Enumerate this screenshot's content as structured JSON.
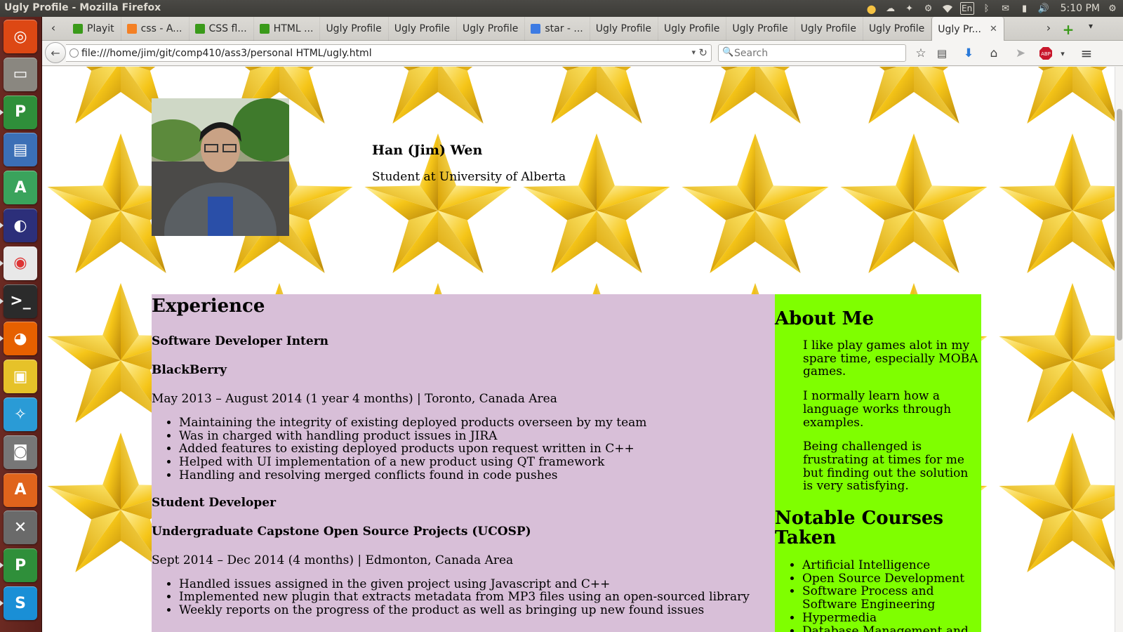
{
  "window": {
    "title": "Ugly Profile - Mozilla Firefox"
  },
  "panel": {
    "keyboard_layout": "En",
    "clock": "5:10 PM"
  },
  "launcher": {
    "items": [
      "Dash Home",
      "Files",
      "PyCharm",
      "LibreOffice Writer",
      "Android Studio",
      "Eclipse",
      "Google Chrome",
      "Terminal",
      "Firefox",
      "Impress",
      "Cursor Tool",
      "Camera",
      "Software Center",
      "System Settings",
      "PyCharm",
      "Skype"
    ]
  },
  "tabs": [
    {
      "label": "Playit",
      "favicon": "green"
    },
    {
      "label": "css - A...",
      "favicon": "stack"
    },
    {
      "label": "CSS fl...",
      "favicon": "green"
    },
    {
      "label": "HTML ...",
      "favicon": "green"
    },
    {
      "label": "Ugly Profile",
      "favicon": "none"
    },
    {
      "label": "Ugly Profile",
      "favicon": "none"
    },
    {
      "label": "Ugly Profile",
      "favicon": "none"
    },
    {
      "label": "star - ...",
      "favicon": "google"
    },
    {
      "label": "Ugly Profile",
      "favicon": "none"
    },
    {
      "label": "Ugly Profile",
      "favicon": "none"
    },
    {
      "label": "Ugly Profile",
      "favicon": "none"
    },
    {
      "label": "Ugly Profile",
      "favicon": "none"
    },
    {
      "label": "Ugly Profile",
      "favicon": "none"
    },
    {
      "label": "Ugly Pr...",
      "favicon": "none",
      "active": true
    }
  ],
  "navbar": {
    "url": "file:///home/jim/git/comp410/ass3/personal HTML/ugly.html",
    "search_placeholder": "Search"
  },
  "profile": {
    "name": "Han (Jim) Wen",
    "tagline": "Student at University of Alberta"
  },
  "experience": {
    "heading": "Experience",
    "jobs": [
      {
        "title": "Software Developer Intern",
        "company": "BlackBerry",
        "period": "May 2013 – August 2014 (1 year 4 months) | Toronto, Canada Area",
        "duties": [
          "Maintaining the integrity of existing deployed products overseen by my team",
          "Was in charged with handling product issues in JIRA",
          "Added features to existing deployed products upon request written in C++",
          "Helped with UI implementation of a new product using QT framework",
          "Handling and resolving merged conflicts found in code pushes"
        ]
      },
      {
        "title": "Student Developer",
        "company": "Undergraduate Capstone Open Source Projects (UCOSP)",
        "period": "Sept 2014 – Dec 2014 (4 months) | Edmonton, Canada Area",
        "duties": [
          "Handled issues assigned in the given project using Javascript and C++",
          "Implemented new plugin that extracts metadata from MP3 files using an open-sourced library",
          "Weekly reports on the progress of the product as well as bringing up new found issues"
        ]
      }
    ]
  },
  "about": {
    "heading": "About Me",
    "paragraphs": [
      "I like play games alot in my spare time, especially MOBA games.",
      "I normally learn how a language works through examples.",
      "Being challenged is frustrating at times for me but finding out the solution is very satisfying."
    ],
    "courses_heading": "Notable Courses Taken",
    "courses": [
      "Artificial Intelligence",
      "Open Source Development",
      "Software Process and Software Engineering",
      "Hypermedia",
      "Database Management and"
    ]
  },
  "colors": {
    "experience_bg": "#d8bfd8",
    "about_bg": "#7fff00",
    "star_gold": "#f5c518",
    "launcher_bg": "#5a1f1a"
  }
}
